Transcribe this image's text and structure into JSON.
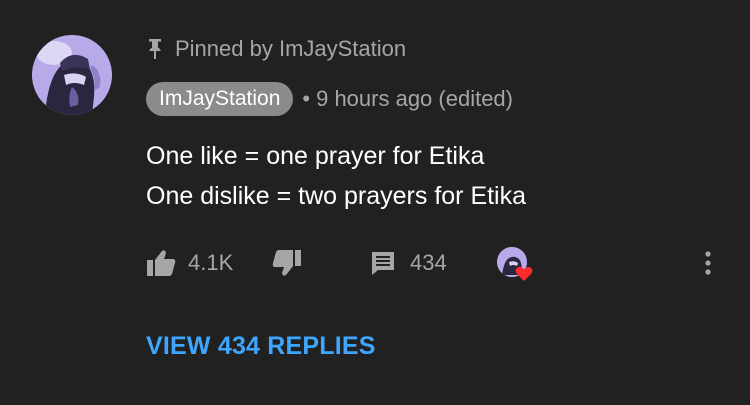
{
  "comment": {
    "pinned_label": "Pinned by ImJayStation",
    "author": "ImJayStation",
    "separator": "•",
    "time": "9 hours ago (edited)",
    "text_lines": [
      "One like = one prayer for Etika",
      "One dislike = two prayers for Etika"
    ]
  },
  "actions": {
    "like_count": "4.1K",
    "reply_count": "434"
  },
  "view_replies": "VIEW 434 REPLIES",
  "icons": {
    "pin": "pin-icon",
    "thumb_up": "thumbs-up-icon",
    "thumb_down": "thumbs-down-icon",
    "reply": "comment-icon",
    "heart": "heart-icon",
    "more": "more-vertical-icon"
  },
  "colors": {
    "background": "#212121",
    "text": "#ffffff",
    "secondary": "#a6a6a6",
    "author_chip": "#8b8b8b",
    "link": "#3ea6ff",
    "heart": "#ff2b2b"
  }
}
